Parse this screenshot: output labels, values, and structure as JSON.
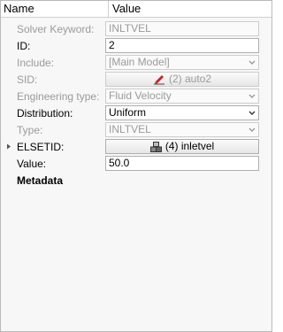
{
  "header": {
    "name": "Name",
    "value": "Value"
  },
  "rows": {
    "solver_keyword": {
      "label": "Solver Keyword:",
      "value": "INLTVEL"
    },
    "id": {
      "label": "ID:",
      "value": "2"
    },
    "include": {
      "label": "Include:",
      "value": "[Main Model]"
    },
    "sid": {
      "label": "SID:",
      "value": "(2) auto2",
      "icon": "pen-icon",
      "icon_color": "#cc2222"
    },
    "engineering_type": {
      "label": "Engineering type:",
      "value": "Fluid Velocity"
    },
    "distribution": {
      "label": "Distribution:",
      "value": "Uniform"
    },
    "type": {
      "label": "Type:",
      "value": "INLTVEL"
    },
    "elsetid": {
      "label": "ELSETID:",
      "value": "(4) inletvel",
      "icon": "element-set-icon"
    },
    "value": {
      "label": "Value:",
      "value": "50.0"
    }
  },
  "metadata": {
    "label": "Metadata"
  }
}
